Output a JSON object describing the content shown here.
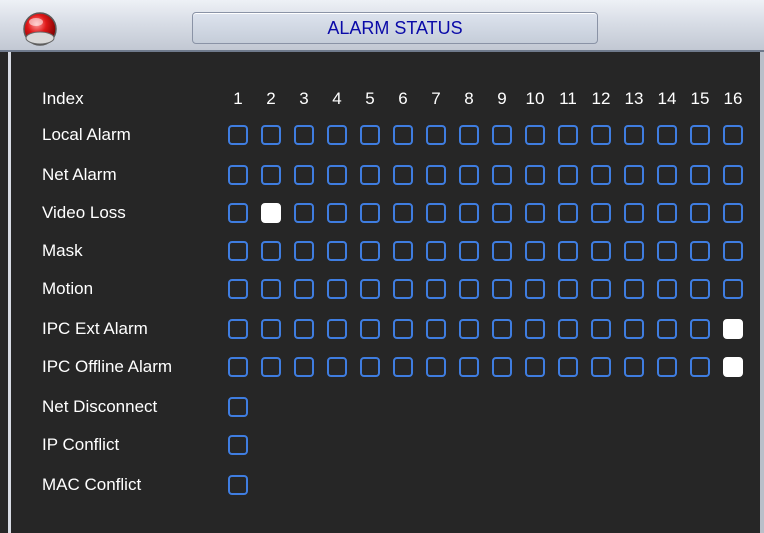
{
  "window": {
    "title": "ALARM STATUS",
    "icon": "red-orb-icon"
  },
  "colors": {
    "checkbox_border": "#3f7de0",
    "checked_fill": "#ffffff",
    "background": "#262626",
    "title_text": "#0a0aa8"
  },
  "index_row": {
    "label": "Index",
    "channels": [
      "1",
      "2",
      "3",
      "4",
      "5",
      "6",
      "7",
      "8",
      "9",
      "10",
      "11",
      "12",
      "13",
      "14",
      "15",
      "16"
    ]
  },
  "alarm_rows": [
    {
      "label": "Local Alarm",
      "states": [
        0,
        0,
        0,
        0,
        0,
        0,
        0,
        0,
        0,
        0,
        0,
        0,
        0,
        0,
        0,
        0
      ]
    },
    {
      "label": "Net Alarm",
      "states": [
        0,
        0,
        0,
        0,
        0,
        0,
        0,
        0,
        0,
        0,
        0,
        0,
        0,
        0,
        0,
        0
      ]
    },
    {
      "label": "Video Loss",
      "states": [
        0,
        1,
        0,
        0,
        0,
        0,
        0,
        0,
        0,
        0,
        0,
        0,
        0,
        0,
        0,
        0
      ]
    },
    {
      "label": "Mask",
      "states": [
        0,
        0,
        0,
        0,
        0,
        0,
        0,
        0,
        0,
        0,
        0,
        0,
        0,
        0,
        0,
        0
      ]
    },
    {
      "label": "Motion",
      "states": [
        0,
        0,
        0,
        0,
        0,
        0,
        0,
        0,
        0,
        0,
        0,
        0,
        0,
        0,
        0,
        0
      ]
    },
    {
      "label": "IPC Ext Alarm",
      "states": [
        0,
        0,
        0,
        0,
        0,
        0,
        0,
        0,
        0,
        0,
        0,
        0,
        0,
        0,
        0,
        1
      ]
    },
    {
      "label": "IPC Offline Alarm",
      "states": [
        0,
        0,
        0,
        0,
        0,
        0,
        0,
        0,
        0,
        0,
        0,
        0,
        0,
        0,
        0,
        1
      ]
    }
  ],
  "single_rows": [
    {
      "label": "Net Disconnect",
      "state": 0
    },
    {
      "label": "IP Conflict",
      "state": 0
    },
    {
      "label": "MAC Conflict",
      "state": 0
    }
  ]
}
